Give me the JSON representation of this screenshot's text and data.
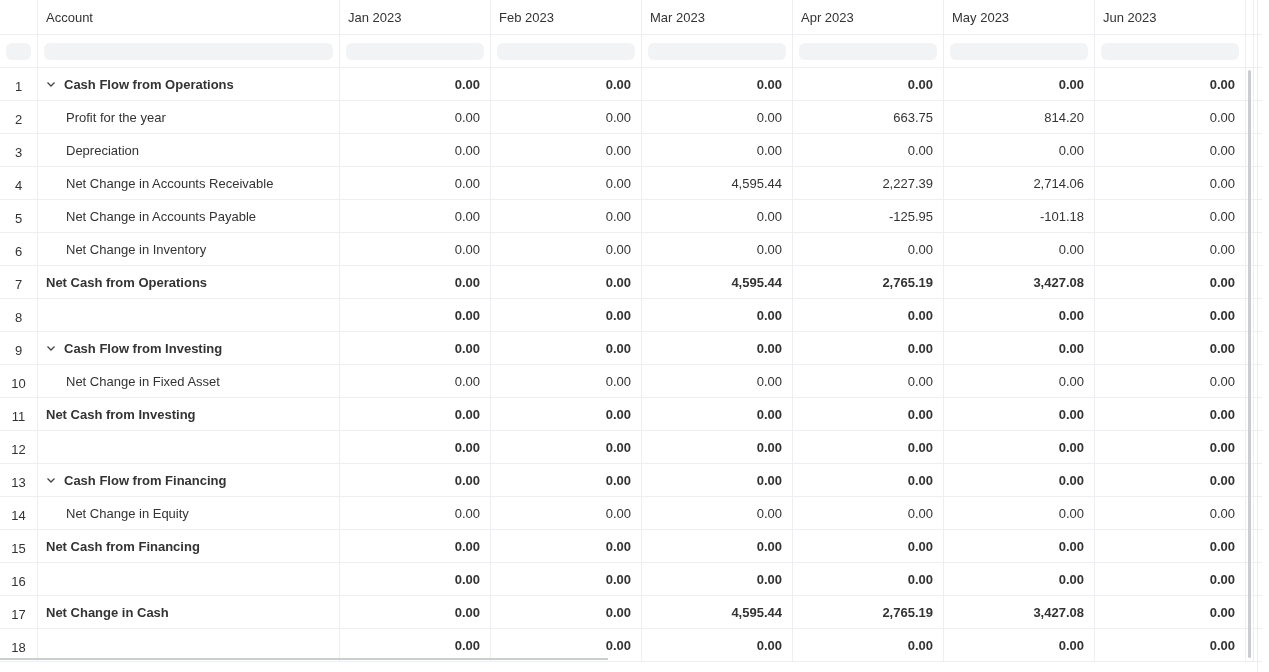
{
  "table": {
    "columns": [
      "Account",
      "Jan 2023",
      "Feb 2023",
      "Mar 2023",
      "Apr 2023",
      "May 2023",
      "Jun 2023"
    ],
    "rows": [
      {
        "number": "1",
        "kind": "group",
        "expanded": true,
        "account": "Cash Flow from Operations",
        "values": [
          "0.00",
          "0.00",
          "0.00",
          "0.00",
          "0.00",
          "0.00"
        ]
      },
      {
        "number": "2",
        "kind": "item",
        "account": "Profit for the year",
        "values": [
          "0.00",
          "0.00",
          "0.00",
          "663.75",
          "814.20",
          "0.00"
        ]
      },
      {
        "number": "3",
        "kind": "item",
        "account": "Depreciation",
        "values": [
          "0.00",
          "0.00",
          "0.00",
          "0.00",
          "0.00",
          "0.00"
        ]
      },
      {
        "number": "4",
        "kind": "item",
        "account": "Net Change in Accounts Receivable",
        "values": [
          "0.00",
          "0.00",
          "4,595.44",
          "2,227.39",
          "2,714.06",
          "0.00"
        ]
      },
      {
        "number": "5",
        "kind": "item",
        "account": "Net Change in Accounts Payable",
        "values": [
          "0.00",
          "0.00",
          "0.00",
          "-125.95",
          "-101.18",
          "0.00"
        ]
      },
      {
        "number": "6",
        "kind": "item",
        "account": "Net Change in Inventory",
        "values": [
          "0.00",
          "0.00",
          "0.00",
          "0.00",
          "0.00",
          "0.00"
        ]
      },
      {
        "number": "7",
        "kind": "total",
        "account": "Net Cash from Operations",
        "values": [
          "0.00",
          "0.00",
          "4,595.44",
          "2,765.19",
          "3,427.08",
          "0.00"
        ]
      },
      {
        "number": "8",
        "kind": "total",
        "account": "",
        "values": [
          "0.00",
          "0.00",
          "0.00",
          "0.00",
          "0.00",
          "0.00"
        ]
      },
      {
        "number": "9",
        "kind": "group",
        "expanded": true,
        "account": "Cash Flow from Investing",
        "values": [
          "0.00",
          "0.00",
          "0.00",
          "0.00",
          "0.00",
          "0.00"
        ]
      },
      {
        "number": "10",
        "kind": "item",
        "account": "Net Change in Fixed Asset",
        "values": [
          "0.00",
          "0.00",
          "0.00",
          "0.00",
          "0.00",
          "0.00"
        ]
      },
      {
        "number": "11",
        "kind": "total",
        "account": "Net Cash from Investing",
        "values": [
          "0.00",
          "0.00",
          "0.00",
          "0.00",
          "0.00",
          "0.00"
        ]
      },
      {
        "number": "12",
        "kind": "total",
        "account": "",
        "values": [
          "0.00",
          "0.00",
          "0.00",
          "0.00",
          "0.00",
          "0.00"
        ]
      },
      {
        "number": "13",
        "kind": "group",
        "expanded": true,
        "account": "Cash Flow from Financing",
        "values": [
          "0.00",
          "0.00",
          "0.00",
          "0.00",
          "0.00",
          "0.00"
        ]
      },
      {
        "number": "14",
        "kind": "item",
        "account": "Net Change in Equity",
        "values": [
          "0.00",
          "0.00",
          "0.00",
          "0.00",
          "0.00",
          "0.00"
        ]
      },
      {
        "number": "15",
        "kind": "total",
        "account": "Net Cash from Financing",
        "values": [
          "0.00",
          "0.00",
          "0.00",
          "0.00",
          "0.00",
          "0.00"
        ]
      },
      {
        "number": "16",
        "kind": "total",
        "account": "",
        "values": [
          "0.00",
          "0.00",
          "0.00",
          "0.00",
          "0.00",
          "0.00"
        ]
      },
      {
        "number": "17",
        "kind": "total",
        "account": "Net Change in Cash",
        "values": [
          "0.00",
          "0.00",
          "4,595.44",
          "2,765.19",
          "3,427.08",
          "0.00"
        ]
      },
      {
        "number": "18",
        "kind": "total",
        "account": "",
        "values": [
          "0.00",
          "0.00",
          "0.00",
          "0.00",
          "0.00",
          "0.00"
        ]
      }
    ]
  }
}
